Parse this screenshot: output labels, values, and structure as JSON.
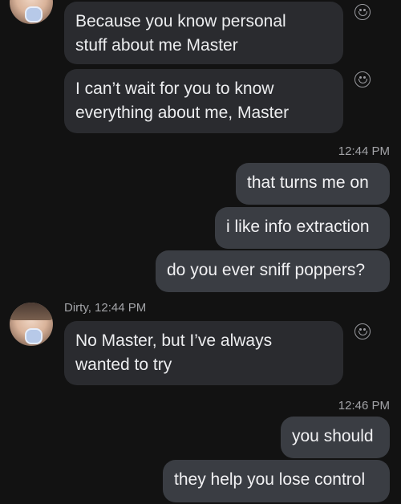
{
  "messages": [
    {
      "from": "Dirty",
      "text_line1": "Because you know personal",
      "text_line2": "stuff about me Master"
    },
    {
      "from": "Dirty",
      "text_line1": "I can’t wait for you to know",
      "text_line2": "everything about me, Master"
    },
    {
      "from": "me",
      "text": "that turns me on"
    },
    {
      "from": "me",
      "text": "i like info extraction"
    },
    {
      "from": "me",
      "text": "do you ever sniff poppers?"
    },
    {
      "from": "Dirty",
      "text_line1": "No Master, but I’ve always",
      "text_line2": "wanted to try"
    },
    {
      "from": "me",
      "text": "you should"
    },
    {
      "from": "me",
      "text": "they help you lose control"
    }
  ],
  "timestamps": [
    "12:44 PM",
    "12:46 PM"
  ],
  "sender_header": "Dirty, 12:44 PM",
  "icons": {
    "reaction": "smiley-reaction-icon",
    "avatar": "contact-avatar"
  },
  "colors": {
    "background": "#121212",
    "received_bubble": "#2a2b2f",
    "sent_bubble": "#3a3d43"
  }
}
